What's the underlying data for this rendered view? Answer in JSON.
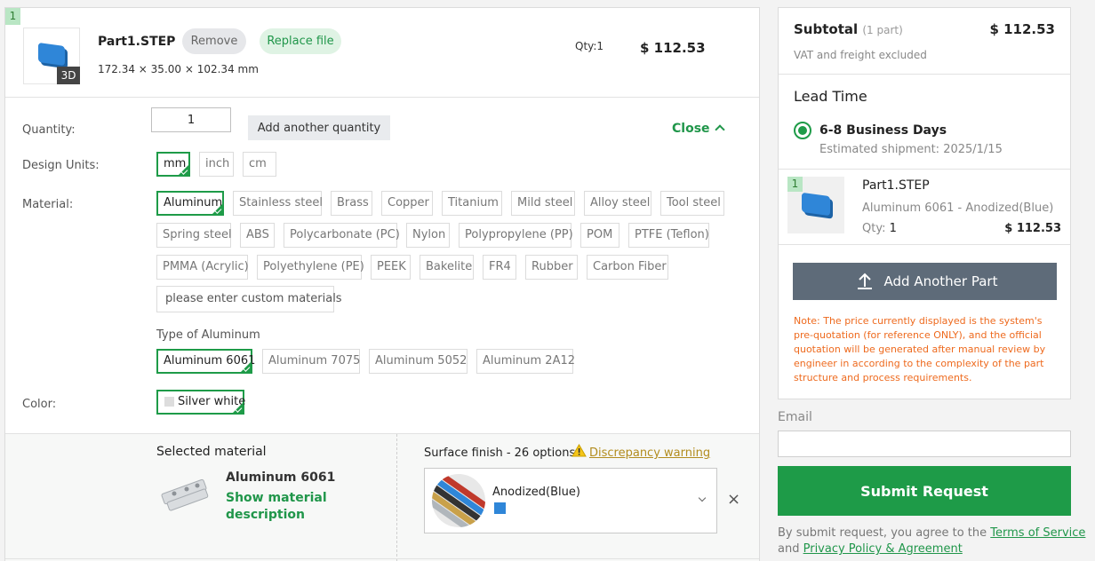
{
  "part": {
    "index": "1",
    "name": "Part1.STEP",
    "badge_3d": "3D",
    "remove_label": "Remove",
    "replace_label": "Replace file",
    "dimensions": "172.34 × 35.00 × 102.34 mm",
    "qty_label": "Qty:1",
    "price": "$ 112.53"
  },
  "form": {
    "quantity_label": "Quantity:",
    "quantity_value": "1",
    "add_quantity_label": "Add another quantity",
    "close_label": "Close",
    "design_units_label": "Design Units:",
    "units": [
      "mm",
      "inch",
      "cm"
    ],
    "material_label": "Material:",
    "materials": [
      "Aluminum",
      "Stainless steel",
      "Brass",
      "Copper",
      "Titanium",
      "Mild steel",
      "Alloy steel",
      "Tool steel",
      "Spring steel",
      "ABS",
      "Polycarbonate (PC)",
      "Nylon",
      "Polypropylene (PP)",
      "POM",
      "PTFE (Teflon)",
      "PMMA (Acrylic)",
      "Polyethylene (PE)",
      "PEEK",
      "Bakelite",
      "FR4",
      "Rubber",
      "Carbon Fiber"
    ],
    "custom_material_label": "please enter custom materials",
    "type_label": "Type of Aluminum",
    "aluminum_types": [
      "Aluminum 6061",
      "Aluminum 7075",
      "Aluminum 5052",
      "Aluminum 2A12"
    ],
    "color_label": "Color:",
    "color_value": "Silver white"
  },
  "selected": {
    "title": "Selected material",
    "material_name": "Aluminum 6061",
    "show_description": "Show material description",
    "finish_label": "Surface finish - 26 options",
    "warning_label": "Discrepancy warning",
    "finish_value": "Anodized(Blue)",
    "finish_color": "#2f86d8"
  },
  "summary": {
    "subtotal_label": "Subtotal",
    "subtotal_count": "(1 part)",
    "subtotal_price": "$ 112.53",
    "vat_note": "VAT and freight excluded",
    "lead_time_title": "Lead Time",
    "lead_option": "6-8 Business Days",
    "shipment": "Estimated shipment: 2025/1/15",
    "item_index": "1",
    "item_name": "Part1.STEP",
    "item_material": "Aluminum 6061 - Anodized(Blue)",
    "item_qty_label": "Qty:",
    "item_qty": "1",
    "item_price": "$ 112.53",
    "add_part_label": "Add Another Part",
    "note": "Note: The price currently displayed is the system's pre-quotation (for reference ONLY), and the official quotation will be generated after manual review by engineer in according to the complexity of the part structure and process requirements."
  },
  "checkout": {
    "email_label": "Email",
    "submit_label": "Submit Request",
    "terms_prefix": "By submit request, you agree to the",
    "terms_link": "Terms of Service",
    "and_text": "and",
    "privacy_link": "Privacy Policy & Agreement"
  },
  "colors": {
    "accent": "#1e9b48",
    "warning": "#ee6a1e",
    "slate": "#5e6b79"
  }
}
